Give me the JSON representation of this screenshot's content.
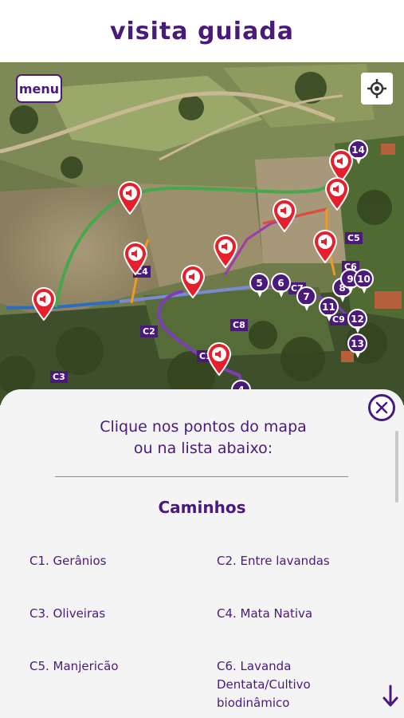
{
  "header": {
    "title": "visita guiada"
  },
  "map": {
    "menu_label": "menu",
    "audio_pins": [
      "C1",
      "C2",
      "C3",
      "C4",
      "C5",
      "C6",
      "C7",
      "C8",
      "C9",
      "C10"
    ],
    "number_pins": [
      "4",
      "5",
      "6",
      "7",
      "8",
      "9",
      "10",
      "11",
      "12",
      "13",
      "14"
    ]
  },
  "panel": {
    "instruction_line1": "Clique nos pontos do mapa",
    "instruction_line2": "ou na lista abaixo:",
    "section_title": "Caminhos",
    "items": [
      "C1. Gerânios",
      "C2. Entre lavandas",
      "C3. Oliveiras",
      "C4. Mata Nativa",
      "C5. Manjericão",
      "C6. Lavanda Dentata/Cultivo biodinâmico"
    ]
  },
  "colors": {
    "brand": "#4a1a7a",
    "pin_red": "#e5202c"
  }
}
